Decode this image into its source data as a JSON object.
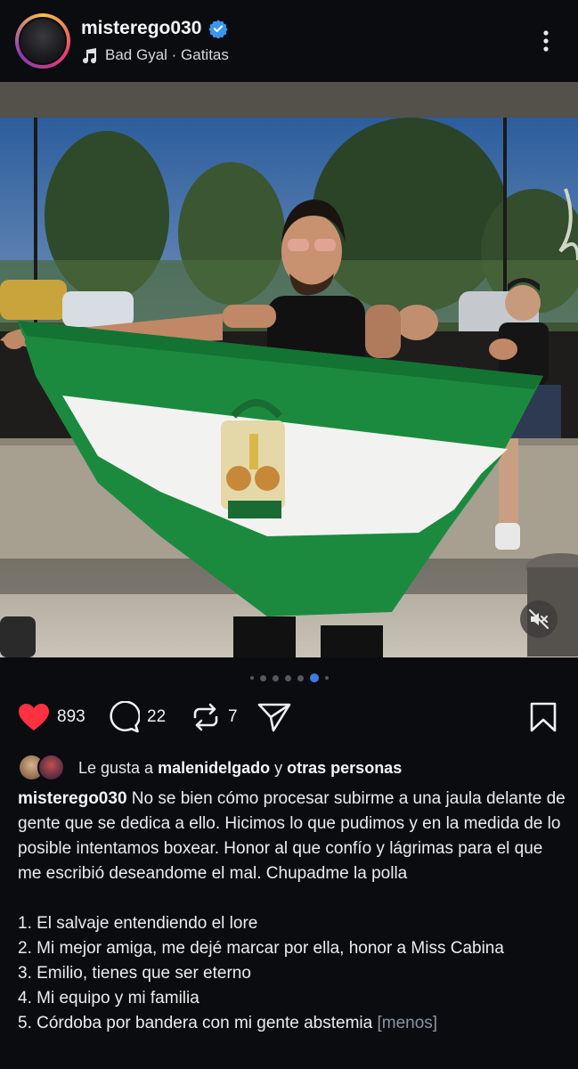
{
  "header": {
    "username": "misterego030",
    "verified": true,
    "music": "Bad Gyal · Gatitas"
  },
  "media": {
    "carousel_count": 8,
    "carousel_active_index": 6
  },
  "actions": {
    "likes": "893",
    "comments": "22",
    "reposts": "7"
  },
  "liked_by": {
    "prefix": "Le gusta a",
    "user": "malenidelgado",
    "connector": "y",
    "others": "otras personas"
  },
  "caption": {
    "username": "misterego030",
    "text": "No se bien cómo procesar subirme a una jaula delante de gente que se dedica a ello. Hicimos lo que pudimos y en la medida de lo posible intentamos boxear. Honor al que confío y lágrimas para el que me escribió deseandome el mal. Chupadme la polla",
    "list": [
      "1. El salvaje entendiendo el lore",
      "2. Mi mejor amiga, me dejé marcar por ella, honor a Miss Cabina",
      "3. Emilio, tienes que ser eterno",
      "4. Mi equipo y mi familia",
      "5. Córdoba por bandera con mi gente abstemia"
    ],
    "less_label": "[menos]"
  },
  "colors": {
    "background": "#0b0c10",
    "verified": "#3897f0",
    "like": "#ff3040",
    "active_dot": "#3e7be8"
  }
}
